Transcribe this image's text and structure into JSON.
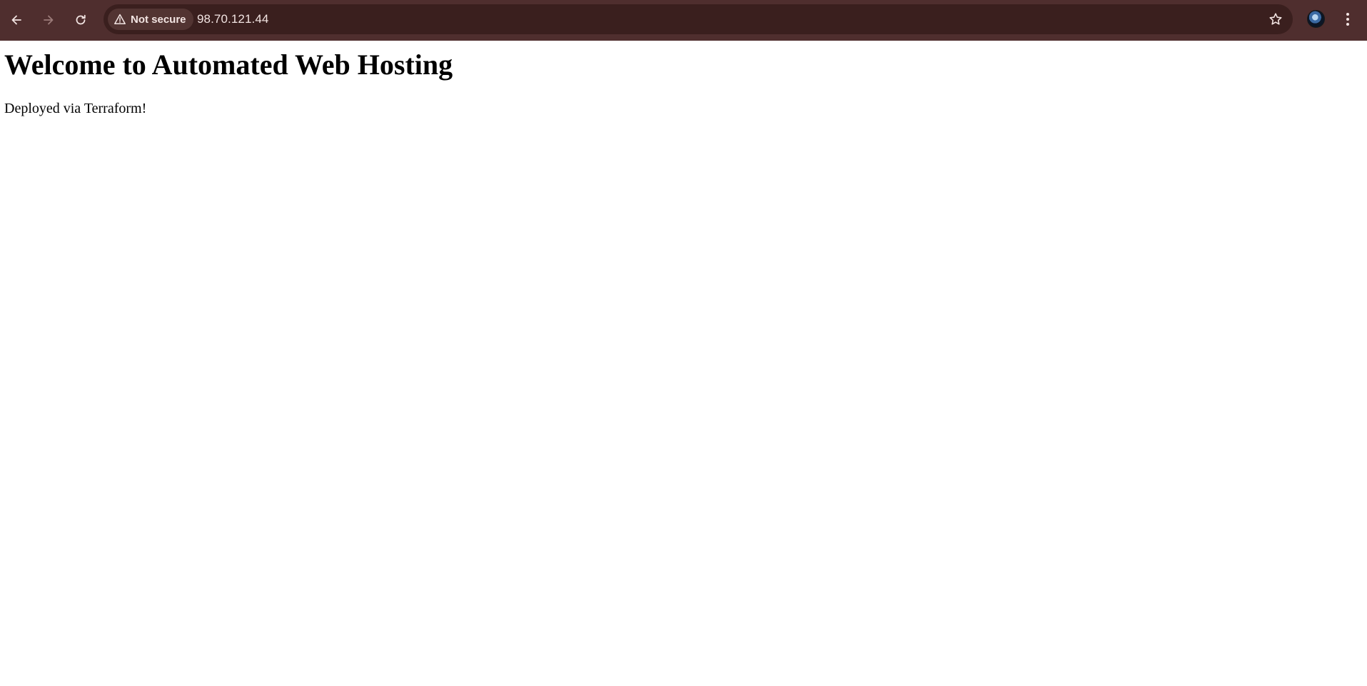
{
  "browser": {
    "toolbar_color": "#4f2e2e",
    "omnibox_color": "#3a1f1e",
    "icons": {
      "back": "back-arrow-icon",
      "forward": "forward-arrow-icon",
      "reload": "reload-icon",
      "warning": "warning-triangle-icon",
      "bookmark": "star-icon",
      "menu": "kebab-menu-icon"
    },
    "security": {
      "label": "Not secure"
    },
    "url": "98.70.121.44"
  },
  "page": {
    "heading": "Welcome to Automated Web Hosting",
    "paragraph": "Deployed via Terraform!"
  }
}
